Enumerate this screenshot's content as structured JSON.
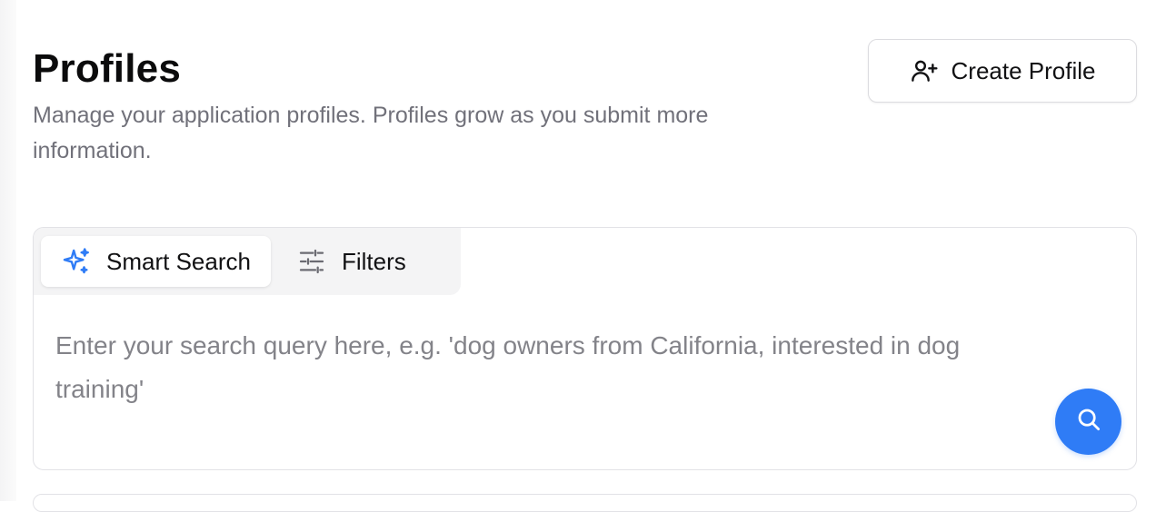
{
  "header": {
    "title": "Profiles",
    "subtitle": "Manage your application profiles. Profiles grow as you submit more information."
  },
  "actions": {
    "create_profile_label": "Create Profile",
    "create_profile_icon": "user-plus-icon"
  },
  "search": {
    "tabs": [
      {
        "label": "Smart Search",
        "icon": "sparkles-icon",
        "active": true
      },
      {
        "label": "Filters",
        "icon": "sliders-icon",
        "active": false
      }
    ],
    "query_value": "",
    "placeholder": "Enter your search query here, e.g. 'dog owners from California, interested in dog training'",
    "submit_icon": "search-icon"
  },
  "colors": {
    "accent": "#2f7cf6",
    "muted_text": "#71717a",
    "border": "#e2e2e6",
    "tab_bar_bg": "#f4f4f5"
  }
}
